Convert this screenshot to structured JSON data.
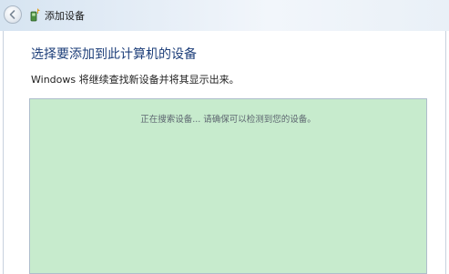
{
  "window": {
    "title": "添加设备",
    "back_icon": "back-arrow-icon",
    "title_icon": "add-device-icon"
  },
  "main": {
    "heading": "选择要添加到此计算机的设备",
    "description": "Windows 将继续查找新设备并将其显示出来。",
    "status_text": "正在搜索设备... 请确保可以检测到您的设备。"
  }
}
